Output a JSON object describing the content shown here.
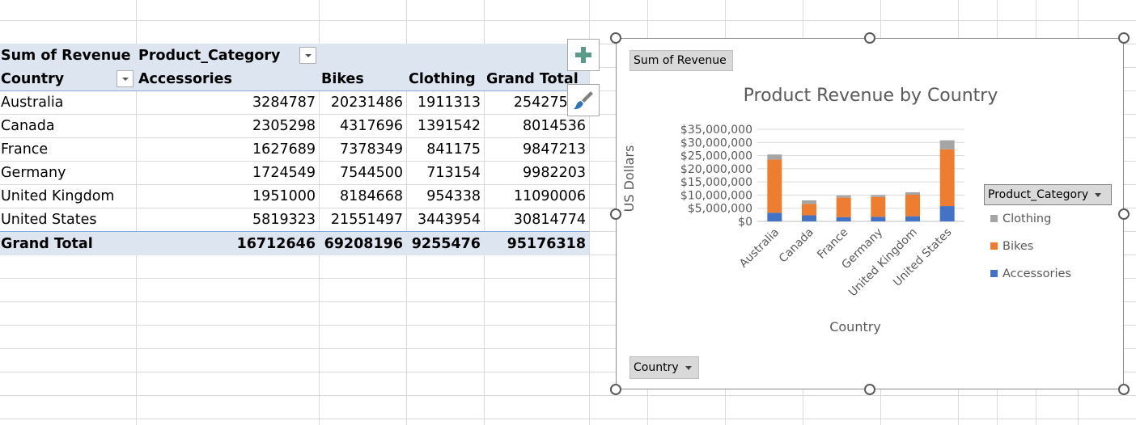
{
  "pivot": {
    "corner_label": "Sum of Revenue",
    "column_field": "Product_Category",
    "row_field": "Country",
    "columns": [
      "Accessories",
      "Bikes",
      "Clothing",
      "Grand Total"
    ],
    "rows": [
      {
        "country": "Australia",
        "values": [
          "3284787",
          "20231486",
          "1911313",
          "25427586"
        ]
      },
      {
        "country": "Canada",
        "values": [
          "2305298",
          "4317696",
          "1391542",
          "8014536"
        ]
      },
      {
        "country": "France",
        "values": [
          "1627689",
          "7378349",
          "841175",
          "9847213"
        ]
      },
      {
        "country": "Germany",
        "values": [
          "1724549",
          "7544500",
          "713154",
          "9982203"
        ]
      },
      {
        "country": "United Kingdom",
        "values": [
          "1951000",
          "8184668",
          "954338",
          "11090006"
        ]
      },
      {
        "country": "United States",
        "values": [
          "5819323",
          "21551497",
          "3443954",
          "30814774"
        ]
      }
    ],
    "grand_total": {
      "label": "Grand Total",
      "values": [
        "16712646",
        "69208196",
        "9255476",
        "95176318"
      ]
    }
  },
  "chart_buttons": {
    "add_icon": "plus-icon",
    "style_icon": "paintbrush-icon"
  },
  "chart_ui": {
    "value_field_button": "Sum of Revenue",
    "axis_field_button": "Country",
    "legend_field_button": "Product_Category"
  },
  "chart_data": {
    "type": "bar",
    "stacked": true,
    "title": "Product Revenue by Country",
    "xlabel": "Country",
    "ylabel": "US Dollars",
    "categories": [
      "Australia",
      "Canada",
      "France",
      "Germany",
      "United Kingdom",
      "United States"
    ],
    "series": [
      {
        "name": "Accessories",
        "color": "#4472c4",
        "values": [
          3284787,
          2305298,
          1627689,
          1724549,
          1951000,
          5819323
        ]
      },
      {
        "name": "Bikes",
        "color": "#ed7d31",
        "values": [
          20231486,
          4317696,
          7378349,
          7544500,
          8184668,
          21551497
        ]
      },
      {
        "name": "Clothing",
        "color": "#a5a5a5",
        "values": [
          1911313,
          1391542,
          841175,
          713154,
          954338,
          3443954
        ]
      }
    ],
    "ylim": [
      0,
      35000000
    ],
    "y_ticks": [
      "$0",
      "$5,000,000",
      "$10,000,000",
      "$15,000,000",
      "$20,000,000",
      "$25,000,000",
      "$30,000,000",
      "$35,000,000"
    ],
    "legend": {
      "position": "right",
      "items": [
        {
          "name": "Clothing",
          "color": "#a5a5a5"
        },
        {
          "name": "Bikes",
          "color": "#ed7d31"
        },
        {
          "name": "Accessories",
          "color": "#4472c4"
        }
      ]
    },
    "grid": true
  }
}
